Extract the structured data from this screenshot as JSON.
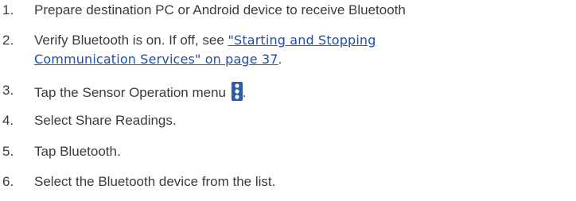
{
  "steps": [
    {
      "number": "1.",
      "text": "Prepare destination PC or Android device to receive Bluetooth"
    },
    {
      "number": "2.",
      "text_before": "Verify Bluetooth is on. If off, see ",
      "link_line1": "\"Starting and Stopping ",
      "link_line2": "Communication Services\" on page 37",
      "text_after": "."
    },
    {
      "number": "3.",
      "text_before": "Tap the Sensor Operation menu ",
      "icon": "sensor-operation-menu-icon",
      "text_after": "."
    },
    {
      "number": "4.",
      "text": "Select Share Readings."
    },
    {
      "number": "5.",
      "text": "Tap Bluetooth."
    },
    {
      "number": "6.",
      "text": "Select the Bluetooth device from the list."
    }
  ],
  "colors": {
    "text": "#3b3b3b",
    "link": "#1f4ea8",
    "icon_fill": "#2f5aa8"
  }
}
